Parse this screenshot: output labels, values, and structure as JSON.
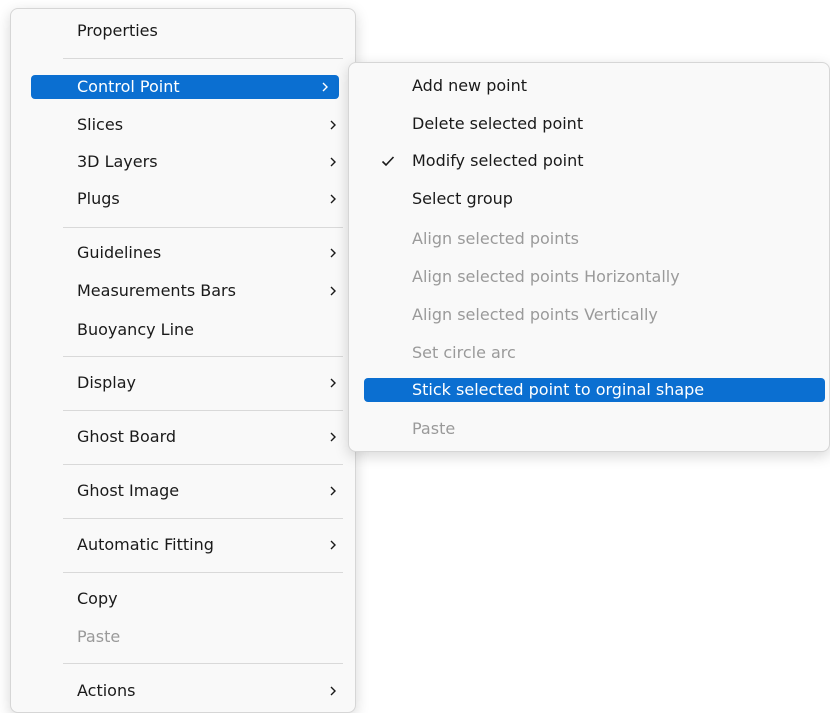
{
  "main_menu": {
    "items": [
      {
        "label": "Properties",
        "has_submenu": false,
        "disabled": false,
        "selected": false
      },
      {
        "label": "Control Point",
        "has_submenu": true,
        "disabled": false,
        "selected": true
      },
      {
        "label": "Slices",
        "has_submenu": true,
        "disabled": false,
        "selected": false
      },
      {
        "label": "3D Layers",
        "has_submenu": true,
        "disabled": false,
        "selected": false
      },
      {
        "label": "Plugs",
        "has_submenu": true,
        "disabled": false,
        "selected": false
      },
      {
        "label": "Guidelines",
        "has_submenu": true,
        "disabled": false,
        "selected": false
      },
      {
        "label": "Measurements Bars",
        "has_submenu": true,
        "disabled": false,
        "selected": false
      },
      {
        "label": "Buoyancy Line",
        "has_submenu": false,
        "disabled": false,
        "selected": false
      },
      {
        "label": "Display",
        "has_submenu": true,
        "disabled": false,
        "selected": false
      },
      {
        "label": "Ghost Board",
        "has_submenu": true,
        "disabled": false,
        "selected": false
      },
      {
        "label": "Ghost Image",
        "has_submenu": true,
        "disabled": false,
        "selected": false
      },
      {
        "label": "Automatic Fitting",
        "has_submenu": true,
        "disabled": false,
        "selected": false
      },
      {
        "label": "Copy",
        "has_submenu": false,
        "disabled": false,
        "selected": false
      },
      {
        "label": "Paste",
        "has_submenu": false,
        "disabled": true,
        "selected": false
      },
      {
        "label": "Actions",
        "has_submenu": true,
        "disabled": false,
        "selected": false
      }
    ]
  },
  "control_point_submenu": {
    "items": [
      {
        "label": "Add new point",
        "checked": false,
        "disabled": false,
        "selected": false
      },
      {
        "label": "Delete selected point",
        "checked": false,
        "disabled": false,
        "selected": false
      },
      {
        "label": "Modify selected point",
        "checked": true,
        "disabled": false,
        "selected": false
      },
      {
        "label": "Select group",
        "checked": false,
        "disabled": false,
        "selected": false
      },
      {
        "label": "Align selected points",
        "checked": false,
        "disabled": true,
        "selected": false
      },
      {
        "label": "Align selected points Horizontally",
        "checked": false,
        "disabled": true,
        "selected": false
      },
      {
        "label": "Align selected points Vertically",
        "checked": false,
        "disabled": true,
        "selected": false
      },
      {
        "label": "Set circle arc",
        "checked": false,
        "disabled": true,
        "selected": false
      },
      {
        "label": "Stick selected point to orginal shape",
        "checked": false,
        "disabled": false,
        "selected": true
      },
      {
        "label": "Paste",
        "checked": false,
        "disabled": true,
        "selected": false
      }
    ]
  },
  "icons": {
    "submenu_arrow": "chevron-right-icon",
    "checkmark": "checkmark-icon"
  },
  "colors": {
    "highlight": "#0b6fd1",
    "menu_background": "#f9f9f9",
    "disabled_text": "#9a9a9a"
  }
}
